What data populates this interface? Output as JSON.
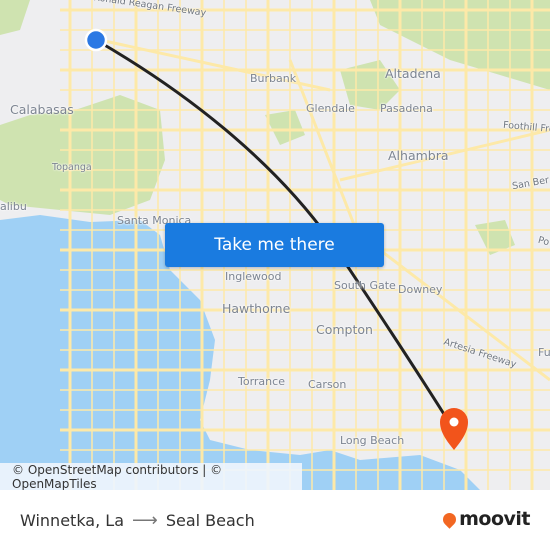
{
  "map": {
    "labels": [
      {
        "text": "Ronald Reagan Freeway",
        "kind": "road"
      },
      {
        "text": "Burbank",
        "kind": "city"
      },
      {
        "text": "Altadena",
        "kind": "city-large"
      },
      {
        "text": "Calabasas",
        "kind": "city-large"
      },
      {
        "text": "Glendale",
        "kind": "city"
      },
      {
        "text": "Pasadena",
        "kind": "city"
      },
      {
        "text": "Foothill Fre",
        "kind": "road"
      },
      {
        "text": "Alhambra",
        "kind": "city-large"
      },
      {
        "text": "Topanga",
        "kind": "small"
      },
      {
        "text": "San Ber",
        "kind": "road"
      },
      {
        "text": "alibu",
        "kind": "city"
      },
      {
        "text": "Santa Monica",
        "kind": "city"
      },
      {
        "text": "Po",
        "kind": "road"
      },
      {
        "text": "Inglewood",
        "kind": "city"
      },
      {
        "text": "South Gate",
        "kind": "city"
      },
      {
        "text": "Downey",
        "kind": "city"
      },
      {
        "text": "Hawthorne",
        "kind": "city-large"
      },
      {
        "text": "Compton",
        "kind": "city-large"
      },
      {
        "text": "Artesia Freeway",
        "kind": "road"
      },
      {
        "text": "Fu",
        "kind": "city"
      },
      {
        "text": "Torrance",
        "kind": "city"
      },
      {
        "text": "Carson",
        "kind": "city"
      },
      {
        "text": "Long Beach",
        "kind": "city"
      }
    ],
    "origin_marker": {
      "name": "Winnetka, La",
      "color": "#2b78e4"
    },
    "destination_marker": {
      "name": "Seal Beach",
      "color": "#f2541b"
    },
    "route_color": "#222222",
    "colors": {
      "water": "#9fd0f5",
      "park": "#cfe3b0",
      "road": "#fde9a8",
      "land": "#eeeef0"
    }
  },
  "cta": {
    "label": "Take me there",
    "color": "#1a7be0"
  },
  "attribution": "© OpenStreetMap contributors | © OpenMapTiles",
  "footer": {
    "origin": "Winnetka, La",
    "arrow": "⟶",
    "destination": "Seal Beach",
    "brand": "moovit",
    "brand_color": "#f26722"
  }
}
